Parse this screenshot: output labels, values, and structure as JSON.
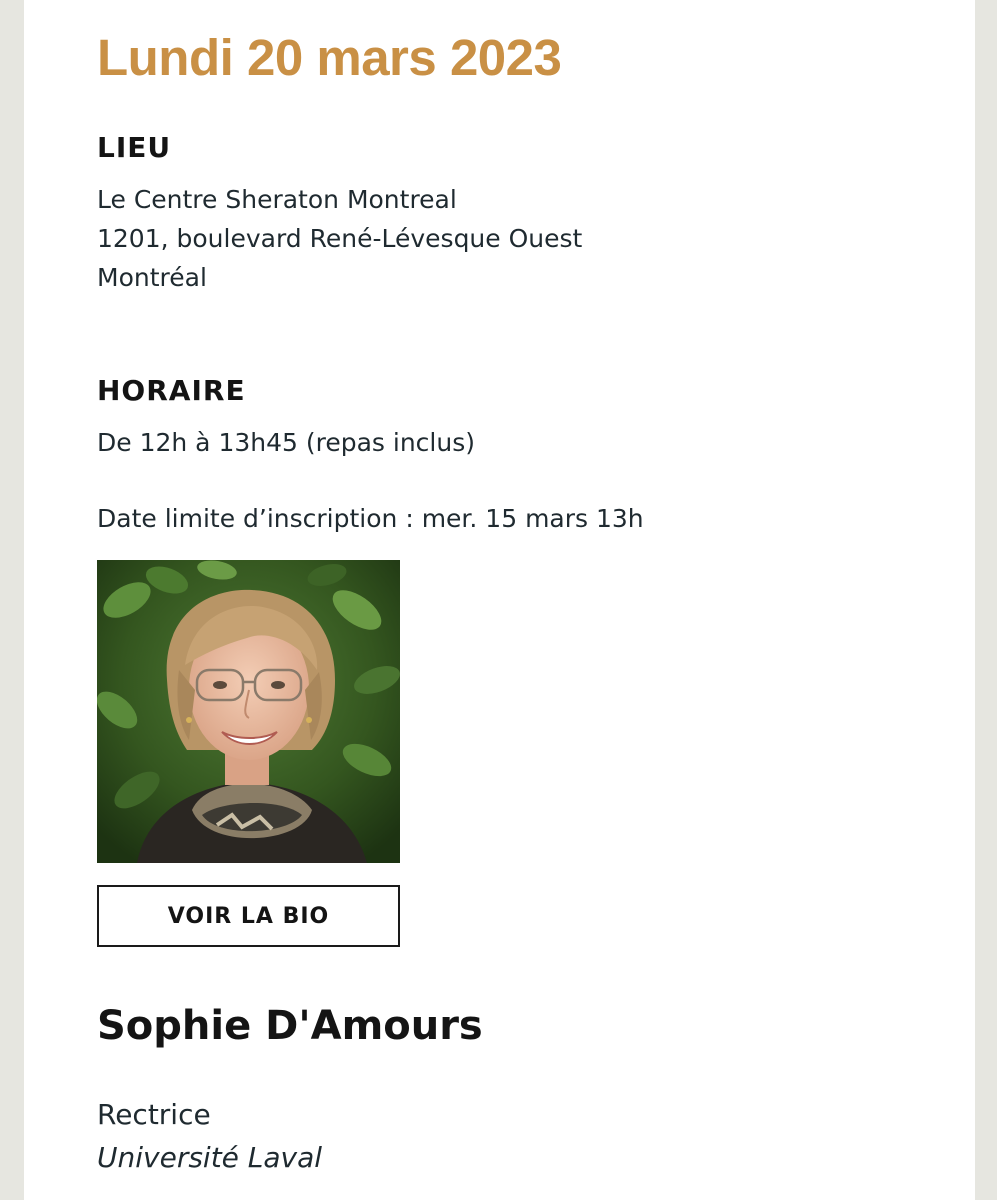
{
  "event": {
    "date": "Lundi 20 mars 2023"
  },
  "location": {
    "heading": "LIEU",
    "lines": [
      "Le Centre Sheraton Montreal",
      "1201, boulevard René-Lévesque Ouest",
      "Montréal"
    ]
  },
  "schedule": {
    "heading": "HORAIRE",
    "time": "De 12h à 13h45 (repas inclus)",
    "deadline": "Date limite d’inscription : mer. 15 mars 13h"
  },
  "speaker": {
    "bio_button_label": "VOIR LA BIO",
    "name": "Sophie D'Amours",
    "role": "Rectrice",
    "organization": "Université Laval"
  },
  "colors": {
    "accent": "#c99045",
    "page_background": "#e6e6e0",
    "card_background": "#ffffff",
    "text": "#1c1c1c"
  }
}
